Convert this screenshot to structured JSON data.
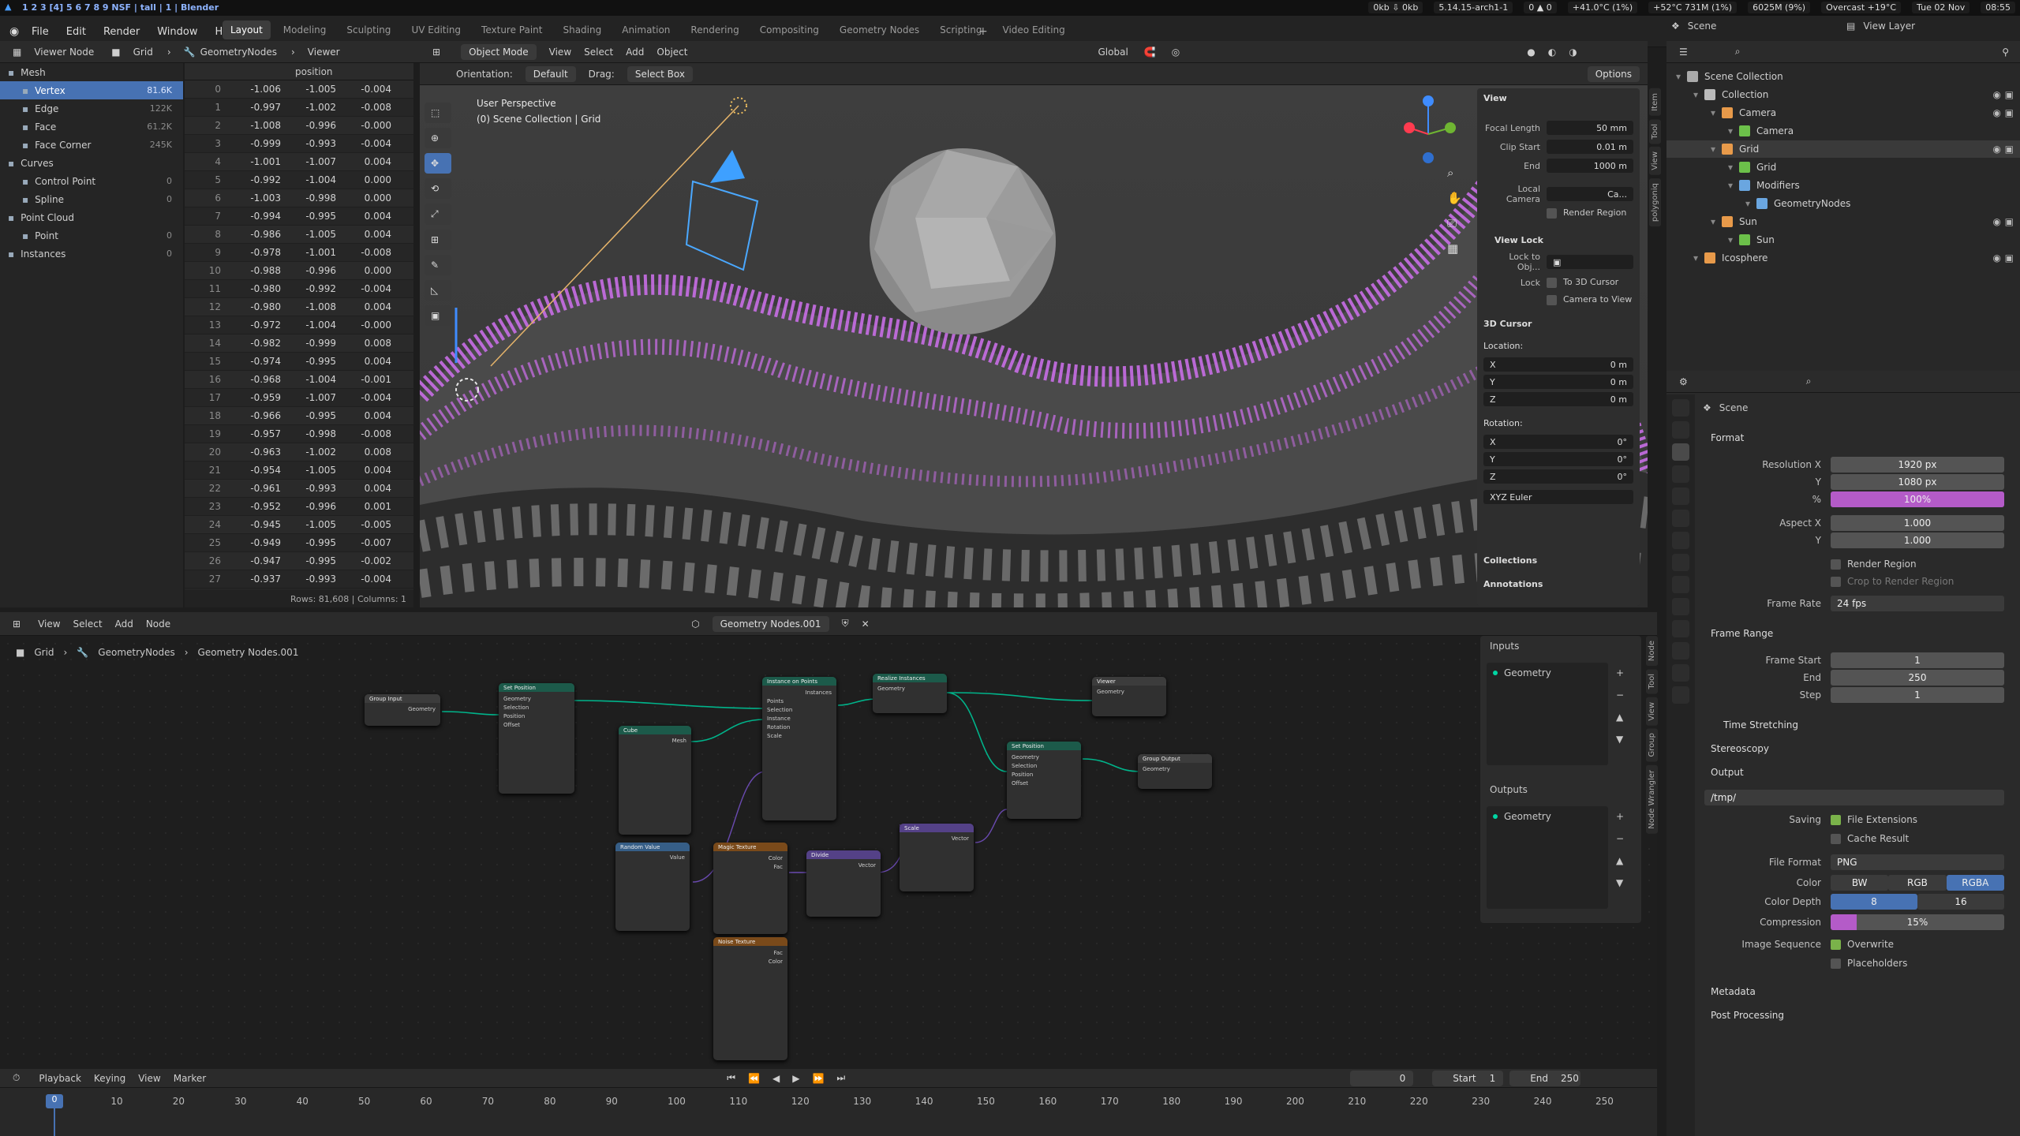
{
  "sysbar": {
    "workspaces": "1 2 3 [4] 5 6 7 8 9 NSF | tall | 1 | Blender",
    "status": [
      "0kb ⇩ 0kb",
      "5.14.15-arch1-1",
      "0 ▲ 0",
      "+41.0°C (1%)",
      "+52°C 731M (1%)",
      "6025M (9%)",
      "Overcast +19°C",
      "Tue 02 Nov",
      "08:55"
    ]
  },
  "menu": {
    "items": [
      "File",
      "Edit",
      "Render",
      "Window",
      "Help"
    ]
  },
  "tabs": [
    "Layout",
    "Modeling",
    "Sculpting",
    "UV Editing",
    "Texture Paint",
    "Shading",
    "Animation",
    "Rendering",
    "Compositing",
    "Geometry Nodes",
    "Scripting",
    "Video Editing"
  ],
  "top_right": {
    "scene": "Scene",
    "view_layer": "View Layer"
  },
  "spreadsheet": {
    "header": {
      "mode": "Viewer Node",
      "object": "Grid",
      "modifier": "GeometryNodes",
      "node": "Viewer"
    },
    "tree": [
      {
        "label": "Mesh",
        "count": "",
        "indent": 0
      },
      {
        "label": "Vertex",
        "count": "81.6K",
        "indent": 1,
        "sel": true
      },
      {
        "label": "Edge",
        "count": "122K",
        "indent": 1
      },
      {
        "label": "Face",
        "count": "61.2K",
        "indent": 1
      },
      {
        "label": "Face Corner",
        "count": "245K",
        "indent": 1
      },
      {
        "label": "Curves",
        "count": "",
        "indent": 0
      },
      {
        "label": "Control Point",
        "count": "0",
        "indent": 1
      },
      {
        "label": "Spline",
        "count": "0",
        "indent": 1
      },
      {
        "label": "Point Cloud",
        "count": "",
        "indent": 0
      },
      {
        "label": "Point",
        "count": "0",
        "indent": 1
      },
      {
        "label": "Instances",
        "count": "0",
        "indent": 0
      }
    ],
    "column_header": "position",
    "rows": [
      [
        "0",
        "-1.006",
        "-1.005",
        "-0.004"
      ],
      [
        "1",
        "-0.997",
        "-1.002",
        "-0.008"
      ],
      [
        "2",
        "-1.008",
        "-0.996",
        "-0.000"
      ],
      [
        "3",
        "-0.999",
        "-0.993",
        "-0.004"
      ],
      [
        "4",
        "-1.001",
        "-1.007",
        "0.004"
      ],
      [
        "5",
        "-0.992",
        "-1.004",
        "0.000"
      ],
      [
        "6",
        "-1.003",
        "-0.998",
        "0.000"
      ],
      [
        "7",
        "-0.994",
        "-0.995",
        "0.004"
      ],
      [
        "8",
        "-0.986",
        "-1.005",
        "0.004"
      ],
      [
        "9",
        "-0.978",
        "-1.001",
        "-0.008"
      ],
      [
        "10",
        "-0.988",
        "-0.996",
        "0.000"
      ],
      [
        "11",
        "-0.980",
        "-0.992",
        "-0.004"
      ],
      [
        "12",
        "-0.980",
        "-1.008",
        "0.004"
      ],
      [
        "13",
        "-0.972",
        "-1.004",
        "-0.000"
      ],
      [
        "14",
        "-0.982",
        "-0.999",
        "0.008"
      ],
      [
        "15",
        "-0.974",
        "-0.995",
        "0.004"
      ],
      [
        "16",
        "-0.968",
        "-1.004",
        "-0.001"
      ],
      [
        "17",
        "-0.959",
        "-1.007",
        "-0.004"
      ],
      [
        "18",
        "-0.966",
        "-0.995",
        "0.004"
      ],
      [
        "19",
        "-0.957",
        "-0.998",
        "-0.008"
      ],
      [
        "20",
        "-0.963",
        "-1.002",
        "0.008"
      ],
      [
        "21",
        "-0.954",
        "-1.005",
        "0.004"
      ],
      [
        "22",
        "-0.961",
        "-0.993",
        "0.004"
      ],
      [
        "23",
        "-0.952",
        "-0.996",
        "0.001"
      ],
      [
        "24",
        "-0.945",
        "-1.005",
        "-0.005"
      ],
      [
        "25",
        "-0.949",
        "-0.995",
        "-0.007"
      ],
      [
        "26",
        "-0.947",
        "-0.995",
        "-0.002"
      ],
      [
        "27",
        "-0.937",
        "-0.993",
        "-0.004"
      ]
    ],
    "footer": "Rows: 81,608  |  Columns: 1"
  },
  "viewport": {
    "header": [
      "Object Mode",
      "View",
      "Select",
      "Add",
      "Object",
      "Global"
    ],
    "orientation_label": "Orientation:",
    "orientation": "Default",
    "drag_label": "Drag:",
    "drag": "Select Box",
    "options": "Options",
    "overlay_title": "User Perspective",
    "overlay_sub": "(0) Scene Collection | Grid",
    "accent": "#c86ee6"
  },
  "npanel": {
    "view_title": "View",
    "focal_label": "Focal Length",
    "focal": "50 mm",
    "clip_label": "Clip Start",
    "clip_start": "0.01 m",
    "end_label": "End",
    "clip_end": "1000 m",
    "local_camera": "Local Camera",
    "local_camera_val": "Ca...",
    "render_region": "Render Region",
    "view_lock": "View Lock",
    "lock_obj": "Lock to Obj...",
    "lock": "Lock",
    "to_cursor": "To 3D Cursor",
    "cam_to_view": "Camera to View",
    "cursor_title": "3D Cursor",
    "location": "Location:",
    "x": "X",
    "y": "Y",
    "z": "Z",
    "loc_val": "0 m",
    "rotation": "Rotation:",
    "rot_val": "0°",
    "euler": "XYZ Euler",
    "collections": "Collections",
    "annotations": "Annotations",
    "tabs": [
      "Item",
      "Tool",
      "View",
      "polygoniq"
    ]
  },
  "outliner": {
    "rows": [
      {
        "label": "Scene Collection",
        "indent": 0,
        "color": "#aaaaaa"
      },
      {
        "label": "Collection",
        "indent": 1,
        "color": "#bbbbbb"
      },
      {
        "label": "Camera",
        "indent": 2,
        "color": "#e89a4a"
      },
      {
        "label": "Camera",
        "indent": 3,
        "color": "#6cc04a"
      },
      {
        "label": "Grid",
        "indent": 2,
        "color": "#e89a4a",
        "sel": true
      },
      {
        "label": "Grid",
        "indent": 3,
        "color": "#6cc04a"
      },
      {
        "label": "Modifiers",
        "indent": 3,
        "color": "#6aa6e0"
      },
      {
        "label": "GeometryNodes",
        "indent": 4,
        "color": "#6aa6e0"
      },
      {
        "label": "Sun",
        "indent": 2,
        "color": "#e89a4a"
      },
      {
        "label": "Sun",
        "indent": 3,
        "color": "#6cc04a"
      },
      {
        "label": "Icosphere",
        "indent": 1,
        "color": "#e89a4a"
      }
    ]
  },
  "properties": {
    "scene": "Scene",
    "format": "Format",
    "res_x_label": "Resolution X",
    "res_x": "1920 px",
    "res_y_label": "Y",
    "res_y": "1080 px",
    "pct_label": "%",
    "pct": "100%",
    "aspect_x_label": "Aspect X",
    "aspect_x": "1.000",
    "aspect_y_label": "Y",
    "aspect_y": "1.000",
    "render_region": "Render Region",
    "crop": "Crop to Render Region",
    "fps_label": "Frame Rate",
    "fps": "24 fps",
    "frame_range": "Frame Range",
    "fstart_label": "Frame Start",
    "fstart": "1",
    "fend_label": "End",
    "fend": "250",
    "step_label": "Step",
    "step": "1",
    "time_stretching": "Time Stretching",
    "stereoscopy": "Stereoscopy",
    "output": "Output",
    "path": "/tmp/",
    "saving_label": "Saving",
    "file_ext": "File Extensions",
    "cache": "Cache Result",
    "format_label": "File Format",
    "file_format": "PNG",
    "color_label": "Color",
    "bw": "BW",
    "rgb": "RGB",
    "rgba": "RGBA",
    "depth_label": "Color Depth",
    "d8": "8",
    "d16": "16",
    "compression_label": "Compression",
    "compression": "15%",
    "seq_label": "Image Sequence",
    "overwrite": "Overwrite",
    "placeholders": "Placeholders",
    "metadata": "Metadata",
    "post": "Post Processing"
  },
  "node_editor": {
    "header": [
      "View",
      "Select",
      "Add",
      "Node"
    ],
    "tree_name": "Geometry Nodes.001",
    "breadcrumb": [
      "Grid",
      "GeometryNodes",
      "Geometry Nodes.001"
    ],
    "nodes": {
      "group_input": "Group Input",
      "set_position": "Set Position",
      "cube": "Cube",
      "instance_on_points": "Instance on Points",
      "realize": "Realize Instances",
      "viewer": "Viewer",
      "set_position2": "Set Position",
      "group_output": "Group Output",
      "random_value": "Random Value",
      "magic_texture": "Magic Texture",
      "divide": "Divide",
      "scale": "Scale",
      "noise_texture": "Noise Texture"
    },
    "sockets": {
      "geometry": "Geometry",
      "selection": "Selection",
      "position": "Position",
      "offset": "Offset",
      "mesh": "Mesh",
      "points": "Points",
      "instance": "Instance",
      "rotation": "Rotation",
      "scale": "Scale",
      "value": "Value",
      "vector": "Vector",
      "color": "Color",
      "fac": "Fac",
      "instances": "Instances"
    },
    "iface": {
      "inputs": "Inputs",
      "outputs": "Outputs",
      "geometry": "Geometry"
    },
    "side_tabs": [
      "Node",
      "Tool",
      "View",
      "Group",
      "Node Wrangler"
    ]
  },
  "timeline": {
    "header": [
      "Playback",
      "Keying",
      "View",
      "Marker"
    ],
    "current": "0",
    "start_label": "Start",
    "start": "1",
    "end_label": "End",
    "end": "250",
    "ticks": [
      "0",
      "10",
      "20",
      "30",
      "40",
      "50",
      "60",
      "70",
      "80",
      "90",
      "100",
      "110",
      "120",
      "130",
      "140",
      "150",
      "160",
      "170",
      "180",
      "190",
      "200",
      "210",
      "220",
      "230",
      "240",
      "250"
    ]
  }
}
